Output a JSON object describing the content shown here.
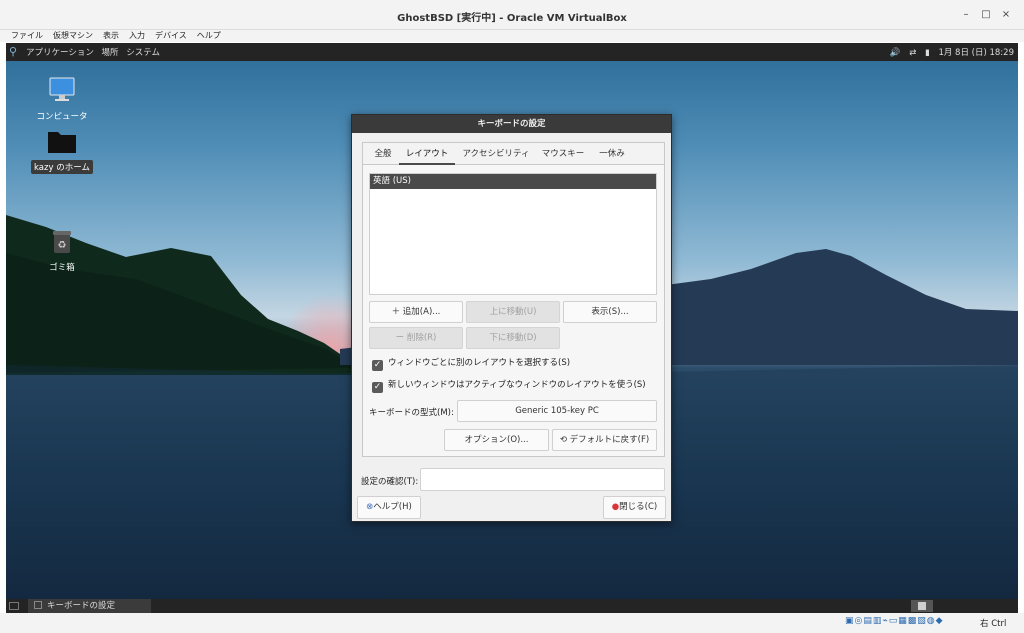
{
  "host": {
    "title": "GhostBSD [実行中] - Oracle VM VirtualBox",
    "window_controls": {
      "minimize": "–",
      "maximize": "□",
      "close": "×"
    },
    "menu": [
      "ファイル",
      "仮想マシン",
      "表示",
      "入力",
      "デバイス",
      "ヘルプ"
    ],
    "statusbar": {
      "host_key": "右 Ctrl"
    }
  },
  "guest": {
    "top_panel": {
      "menus": [
        "アプリケーション",
        "場所",
        "システム"
      ],
      "clock": "1月 8日 (日) 18:29"
    },
    "desktop_icons": [
      {
        "label": "コンピュータ",
        "icon": "monitor-icon"
      },
      {
        "label": "kazy のホーム",
        "icon": "folder-icon"
      },
      {
        "label": "ゴミ箱",
        "icon": "trash-icon"
      }
    ],
    "taskbar": {
      "task_label": "キーボードの設定"
    }
  },
  "dialog": {
    "title": "キーボードの設定",
    "tabs": [
      "全般",
      "レイアウト",
      "アクセシビリティ",
      "マウスキー",
      "一休み"
    ],
    "active_tab": "レイアウト",
    "layouts": [
      "英語 (US)"
    ],
    "buttons": {
      "add": "＋ 追加(A)...",
      "move_up": "上に移動(U)",
      "show": "表示(S)...",
      "remove": "ー 削除(R)",
      "move_down": "下に移動(D)",
      "options": "オプション(O)...",
      "reset": "デフォルトに戻す(F)",
      "help": "ヘルプ(H)",
      "close": "閉じる(C)"
    },
    "checkboxes": [
      {
        "label": "ウィンドウごとに別のレイアウトを選択する(S)",
        "checked": true
      },
      {
        "label": "新しいウィンドウはアクティブなウィンドウのレイアウトを使う(S)",
        "checked": true
      }
    ],
    "model_label": "キーボードの型式(M):",
    "model_value": "Generic 105-key PC",
    "test_label": "設定の確認(T):",
    "test_value": ""
  }
}
